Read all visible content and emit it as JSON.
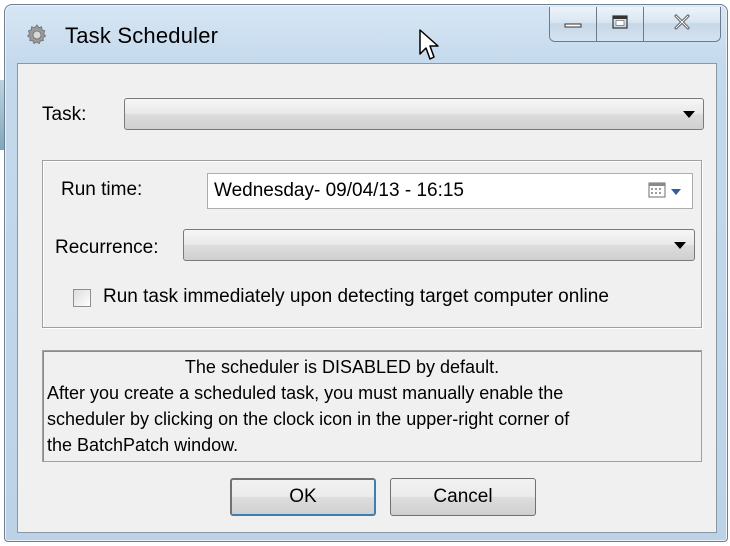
{
  "window": {
    "title": "Task Scheduler"
  },
  "form": {
    "task_label": "Task:",
    "task_value": "",
    "run_time_label": "Run time:",
    "run_time_value": "Wednesday- 09/04/13 - 16:15",
    "recurrence_label": "Recurrence:",
    "recurrence_value": "",
    "run_immediately_label": "Run task immediately upon detecting target computer online",
    "run_immediately_checked": false
  },
  "info": {
    "line1": "The scheduler is DISABLED by default.",
    "line2": "After you create a scheduled task, you must manually enable the",
    "line3": "scheduler by clicking on the clock icon in the upper-right corner of",
    "line4": "the BatchPatch window."
  },
  "buttons": {
    "ok": "OK",
    "cancel": "Cancel"
  },
  "icons": {
    "title": "gear-icon",
    "minimize": "minimize-icon",
    "maximize": "maximize-icon",
    "close": "close-icon",
    "calendar": "calendar-icon",
    "dropdown": "chevron-down-icon"
  }
}
